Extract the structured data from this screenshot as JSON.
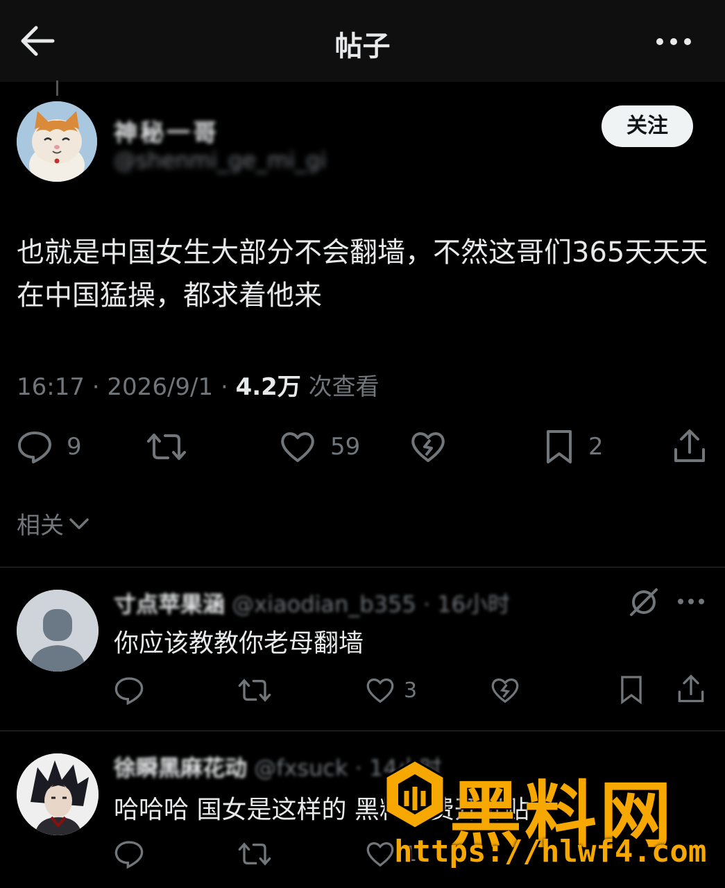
{
  "header": {
    "title": "帖子",
    "back_icon": "arrow-left-icon",
    "more_icon": "more-horizontal-icon"
  },
  "post": {
    "author_name": "神秘一哥",
    "author_handle": "@shenmi_ge_mi_gi",
    "follow_label": "关注",
    "text": "也就是中国女生大部分不会翻墙，不然这哥们365天天天在中国猛操，都求着他来",
    "time": "16:17",
    "date": "2026/9/1",
    "views_count": "4.2万",
    "views_label": "次查看",
    "stats": {
      "replies": "9",
      "reposts": "",
      "likes": "59",
      "bookmarks": "2"
    }
  },
  "related_label": "相关",
  "replies": [
    {
      "name": "寸点苹果涵",
      "handle": "@xiaodian_b355",
      "time_ago": "16小时",
      "text": "你应该教教你老母翻墙",
      "likes": "3"
    },
    {
      "name": "徐瞬黑麻花动",
      "handle": "@fxsuck",
      "time_ago": "14小时",
      "text": "哈哈哈 国女是这样的 黑料免费开屏贴",
      "likes": "1"
    }
  ],
  "watermark": {
    "brand": "黑料网",
    "url": "https://hlwf4.com"
  },
  "colors": {
    "background": "#000000",
    "header_bg": "#0f0f0f",
    "text_primary": "#e7e9ea",
    "text_secondary": "#71767b",
    "follow_bg": "#eff3f4",
    "watermark": "#f6a800"
  }
}
